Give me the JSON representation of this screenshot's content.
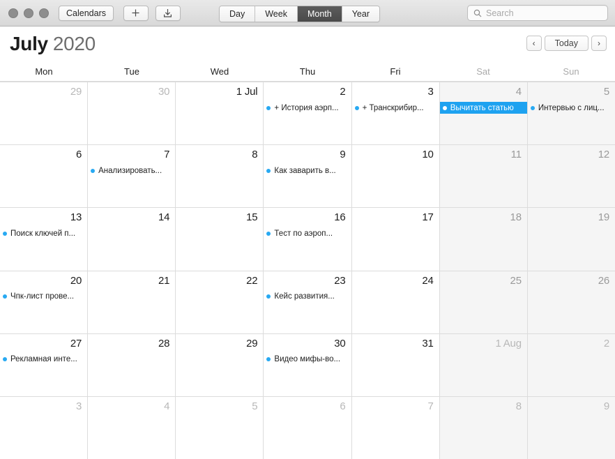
{
  "window": {
    "traffic_lights": [
      "close",
      "minimize",
      "zoom"
    ]
  },
  "toolbar": {
    "calendars_label": "Calendars",
    "add_label": "+",
    "import_icon": "download-icon",
    "view_modes": [
      {
        "label": "Day",
        "active": false
      },
      {
        "label": "Week",
        "active": false
      },
      {
        "label": "Month",
        "active": true
      },
      {
        "label": "Year",
        "active": false
      }
    ],
    "search_placeholder": "Search",
    "search_value": "",
    "search_icon": "search-icon"
  },
  "header": {
    "month": "July",
    "year": "2020",
    "prev_label": "‹",
    "today_label": "Today",
    "next_label": "›"
  },
  "weekdays": [
    {
      "label": "Mon",
      "weekend": false
    },
    {
      "label": "Tue",
      "weekend": false
    },
    {
      "label": "Wed",
      "weekend": false
    },
    {
      "label": "Thu",
      "weekend": false
    },
    {
      "label": "Fri",
      "weekend": false
    },
    {
      "label": "Sat",
      "weekend": true
    },
    {
      "label": "Sun",
      "weekend": true
    }
  ],
  "accent_color": "#1ea2f0",
  "event_dot_color": "#28a9f2",
  "weekend_bg": "#f5f5f5",
  "weeks": [
    {
      "days": [
        {
          "num": "29",
          "state": "other",
          "weekend": false,
          "events": []
        },
        {
          "num": "30",
          "state": "other",
          "weekend": false,
          "events": []
        },
        {
          "num": "1 Jul",
          "state": "current",
          "weekend": false,
          "events": []
        },
        {
          "num": "2",
          "state": "current",
          "weekend": false,
          "events": [
            {
              "title": "+ История аэрп...",
              "selected": false
            }
          ]
        },
        {
          "num": "3",
          "state": "current",
          "weekend": false,
          "events": [
            {
              "title": "+ Транскрибир...",
              "selected": false
            }
          ]
        },
        {
          "num": "4",
          "state": "current",
          "weekend": true,
          "events": [
            {
              "title": "Вычитать статью",
              "selected": true
            }
          ]
        },
        {
          "num": "5",
          "state": "current",
          "weekend": true,
          "events": [
            {
              "title": "Интервью с лиц...",
              "selected": false
            }
          ]
        }
      ]
    },
    {
      "days": [
        {
          "num": "6",
          "state": "current",
          "weekend": false,
          "events": []
        },
        {
          "num": "7",
          "state": "current",
          "weekend": false,
          "events": [
            {
              "title": "Анализировать...",
              "selected": false
            }
          ]
        },
        {
          "num": "8",
          "state": "current",
          "weekend": false,
          "events": []
        },
        {
          "num": "9",
          "state": "current",
          "weekend": false,
          "events": [
            {
              "title": "Как заварить в...",
              "selected": false
            }
          ]
        },
        {
          "num": "10",
          "state": "current",
          "weekend": false,
          "events": []
        },
        {
          "num": "11",
          "state": "current",
          "weekend": true,
          "events": []
        },
        {
          "num": "12",
          "state": "current",
          "weekend": true,
          "events": []
        }
      ]
    },
    {
      "days": [
        {
          "num": "13",
          "state": "current",
          "weekend": false,
          "events": [
            {
              "title": "Поиск ключей п...",
              "selected": false
            }
          ]
        },
        {
          "num": "14",
          "state": "current",
          "weekend": false,
          "events": []
        },
        {
          "num": "15",
          "state": "current",
          "weekend": false,
          "events": []
        },
        {
          "num": "16",
          "state": "current",
          "weekend": false,
          "events": [
            {
              "title": "Тест по аэроп...",
              "selected": false
            }
          ]
        },
        {
          "num": "17",
          "state": "current",
          "weekend": false,
          "events": []
        },
        {
          "num": "18",
          "state": "current",
          "weekend": true,
          "events": []
        },
        {
          "num": "19",
          "state": "current",
          "weekend": true,
          "events": []
        }
      ]
    },
    {
      "days": [
        {
          "num": "20",
          "state": "current",
          "weekend": false,
          "events": [
            {
              "title": "Чпк-лист прове...",
              "selected": false
            }
          ]
        },
        {
          "num": "21",
          "state": "current",
          "weekend": false,
          "events": []
        },
        {
          "num": "22",
          "state": "current",
          "weekend": false,
          "events": []
        },
        {
          "num": "23",
          "state": "current",
          "weekend": false,
          "events": [
            {
              "title": "Кейс развития...",
              "selected": false
            }
          ]
        },
        {
          "num": "24",
          "state": "current",
          "weekend": false,
          "events": []
        },
        {
          "num": "25",
          "state": "current",
          "weekend": true,
          "events": []
        },
        {
          "num": "26",
          "state": "current",
          "weekend": true,
          "events": []
        }
      ]
    },
    {
      "days": [
        {
          "num": "27",
          "state": "current",
          "weekend": false,
          "events": [
            {
              "title": "Рекламная инте...",
              "selected": false
            }
          ]
        },
        {
          "num": "28",
          "state": "current",
          "weekend": false,
          "events": []
        },
        {
          "num": "29",
          "state": "current",
          "weekend": false,
          "events": []
        },
        {
          "num": "30",
          "state": "current",
          "weekend": false,
          "events": [
            {
              "title": "Видео мифы-во...",
              "selected": false
            }
          ]
        },
        {
          "num": "31",
          "state": "current",
          "weekend": false,
          "events": []
        },
        {
          "num": "1 Aug",
          "state": "other",
          "weekend": true,
          "events": []
        },
        {
          "num": "2",
          "state": "other",
          "weekend": true,
          "events": []
        }
      ]
    },
    {
      "days": [
        {
          "num": "3",
          "state": "other",
          "weekend": false,
          "events": []
        },
        {
          "num": "4",
          "state": "other",
          "weekend": false,
          "events": []
        },
        {
          "num": "5",
          "state": "other",
          "weekend": false,
          "events": []
        },
        {
          "num": "6",
          "state": "other",
          "weekend": false,
          "events": []
        },
        {
          "num": "7",
          "state": "other",
          "weekend": false,
          "events": []
        },
        {
          "num": "8",
          "state": "other",
          "weekend": true,
          "events": []
        },
        {
          "num": "9",
          "state": "other",
          "weekend": true,
          "events": []
        }
      ]
    }
  ]
}
